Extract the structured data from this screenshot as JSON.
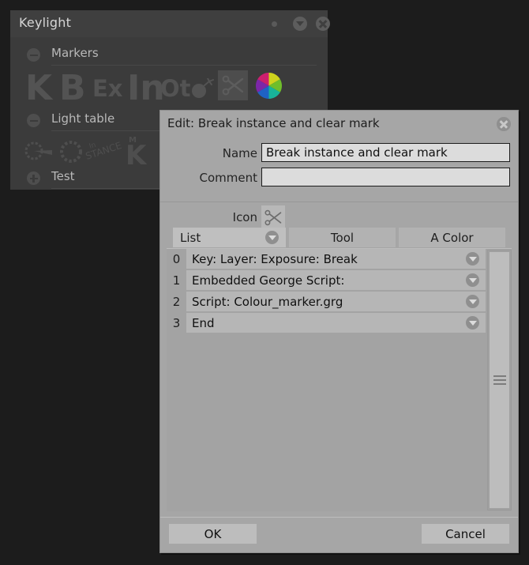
{
  "background_panel": {
    "title": "Keylight",
    "titlebar_icons": [
      "dot-indicator",
      "collapse-icon",
      "close-icon"
    ],
    "sections": [
      {
        "label": "Markers",
        "toggle": "minus-circle-icon"
      },
      {
        "label": "Light table",
        "toggle": "minus-circle-icon"
      },
      {
        "label": "Test",
        "toggle": "plus-circle-icon"
      }
    ],
    "marker_icons": [
      "K",
      "B",
      "Ex",
      "In",
      "Ot",
      "bomb-icon",
      "scissors-icon",
      "color-wheel-icon"
    ],
    "lighttable_icons": [
      "pin-icon",
      "gear-icon",
      "in-stance-icon",
      "k-icon"
    ]
  },
  "dialog": {
    "title": "Edit: Break instance and clear mark",
    "close_icon": "close-icon",
    "fields": {
      "name_label": "Name",
      "name_value": "Break instance and clear mark",
      "comment_label": "Comment",
      "comment_value": "",
      "comment_placeholder": "",
      "icon_label": "Icon",
      "icon_value": "scissors-icon"
    },
    "tabs": [
      {
        "label": "List",
        "has_dropdown": true
      },
      {
        "label": "Tool",
        "has_dropdown": false
      },
      {
        "label": "A Color",
        "has_dropdown": false
      }
    ],
    "list_rows": [
      {
        "index": "0",
        "text": "Key: Layer: Exposure: Break"
      },
      {
        "index": "1",
        "text": "Embedded George Script:"
      },
      {
        "index": "2",
        "text": "Script: Colour_marker.grg"
      },
      {
        "index": "3",
        "text": "End"
      }
    ],
    "buttons": {
      "ok": "OK",
      "cancel": "Cancel"
    }
  },
  "colors": {
    "desktop": "#1c1c1c",
    "panel_bg": "#3b3b3b",
    "dialog_bg": "#a6a6a6",
    "input_bg": "#dcdcdc",
    "row_bg": "#b6b6b6",
    "button_bg": "#bdbdbd"
  }
}
